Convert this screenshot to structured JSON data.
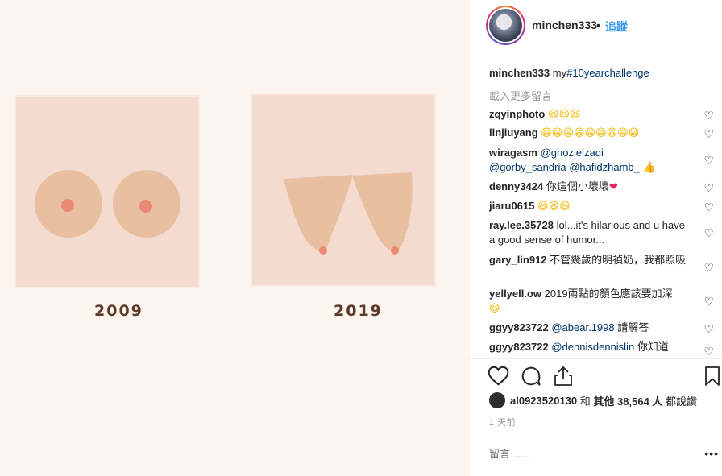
{
  "image": {
    "years": [
      "2009",
      "2019"
    ]
  },
  "header": {
    "username": "minchen333",
    "separator": "•",
    "follow_label": "追蹤"
  },
  "caption": {
    "username": "minchen333",
    "text": "my",
    "hashtag": "#10yearchallenge"
  },
  "load_more_label": "載入更多留言",
  "comments": [
    {
      "user": "zqyinphoto",
      "text": "",
      "emoji": "😆😆😆"
    },
    {
      "user": "linjiuyang",
      "text": "",
      "emoji": "😁😁😁😁😁😁😁😁😁"
    },
    {
      "user": "wiragasm",
      "mention1": "@ghozieizadi",
      "mention2": "@gorby_sandria",
      "mention3": "@hafidzhamb_",
      "emoji": "👍"
    },
    {
      "user": "denny3424",
      "text": "你這個小壞壞",
      "emoji": "❤"
    },
    {
      "user": "jiaru0615",
      "text": "",
      "emoji": "😆😆😆"
    },
    {
      "user": "ray.lee.35728",
      "text": "lol...it's hilarious and u have a good sense of humor..."
    },
    {
      "user": "gary_lin912",
      "text": "不管幾歲的明禎奶，我都照吸"
    },
    {
      "user": "yellyell.ow",
      "text": "2019兩點的顏色應該要加深",
      "emoji": "😆"
    },
    {
      "user": "ggyy823722",
      "mention": "@abear.1998",
      "text": "請解答"
    },
    {
      "user": "ggyy823722",
      "mention": "@dennisdennislin",
      "text": "你知道"
    }
  ],
  "likes": {
    "user": "al0923520130",
    "connector": "和",
    "others_label": "其他 38,564 人",
    "suffix": "都說讚"
  },
  "time_label": "1 天前",
  "comment_input": {
    "placeholder": "留言……"
  },
  "more_label": "•••",
  "icons": {
    "heart": "heart-icon",
    "comment": "comment-icon",
    "share": "share-icon",
    "save": "bookmark-icon",
    "more": "more-icon"
  },
  "colors": {
    "link": "#3897f0",
    "hashtag": "#003569",
    "muted": "#999999",
    "photo_bg": "#fbf4ef",
    "card": "#f3dccf",
    "breast": "#e8bfa1",
    "nipple": "#ea8a73"
  }
}
